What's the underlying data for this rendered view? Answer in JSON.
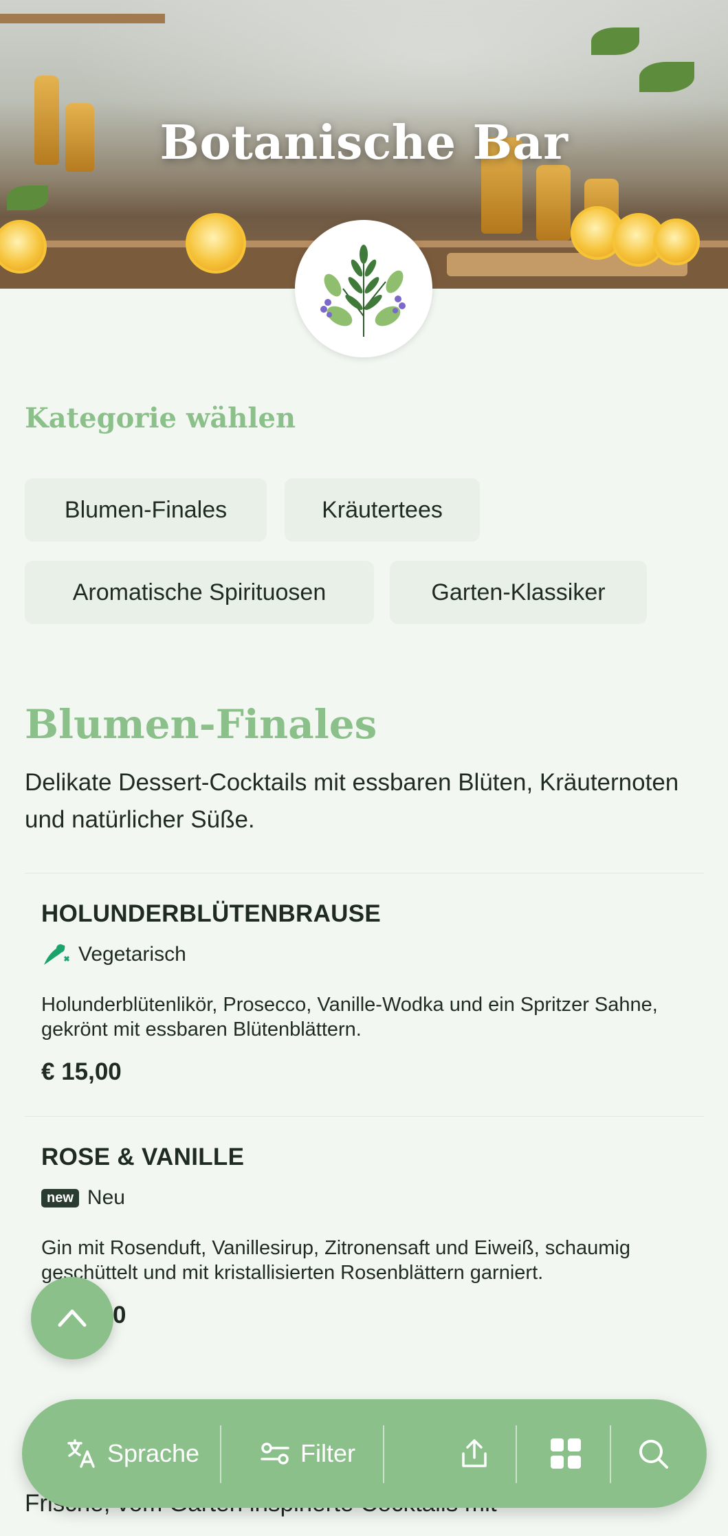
{
  "hero": {
    "title": "Botanische Bar"
  },
  "category": {
    "heading": "Kategorie wählen",
    "chips": [
      "Blumen-Finales",
      "Kräutertees",
      "Aromatische Spirituosen",
      "Garten-Klassiker"
    ]
  },
  "section": {
    "title": "Blumen-Finales",
    "description": "Delikate Dessert-Cocktails mit essbaren Blüten, Kräuternoten und natürlicher Süße."
  },
  "items": [
    {
      "name": "HOLUNDERBLÜTENBRAUSE",
      "tag": "Vegetarisch",
      "tag_icon": "vegetarian-icon",
      "description": "Holunderblütenlikör, Prosecco, Vanille-Wodka und ein Spritzer Sahne, gekrönt mit essbaren Blütenblättern.",
      "price": "€ 15,00"
    },
    {
      "name": "ROSE & VANILLE",
      "badge": "new",
      "tag": "Neu",
      "description": "Gin mit Rosenduft, Vanillesirup, Zitronensaft und Eiweiß, schaumig geschüttelt und mit kristallisierten Rosenblättern garniert.",
      "price": "0"
    }
  ],
  "next_section_text": "Frische, vom Garten inspirierte Cocktails mit",
  "toolbar": {
    "language_label": "Sprache",
    "filter_label": "Filter",
    "icons": [
      "translate-icon",
      "filter-icon",
      "share-icon",
      "grid-icon",
      "search-icon"
    ]
  },
  "colors": {
    "accent": "#8bc08a",
    "background": "#f2f7f1",
    "chip": "#e9f0e7",
    "vegetarian": "#1aa36b"
  }
}
